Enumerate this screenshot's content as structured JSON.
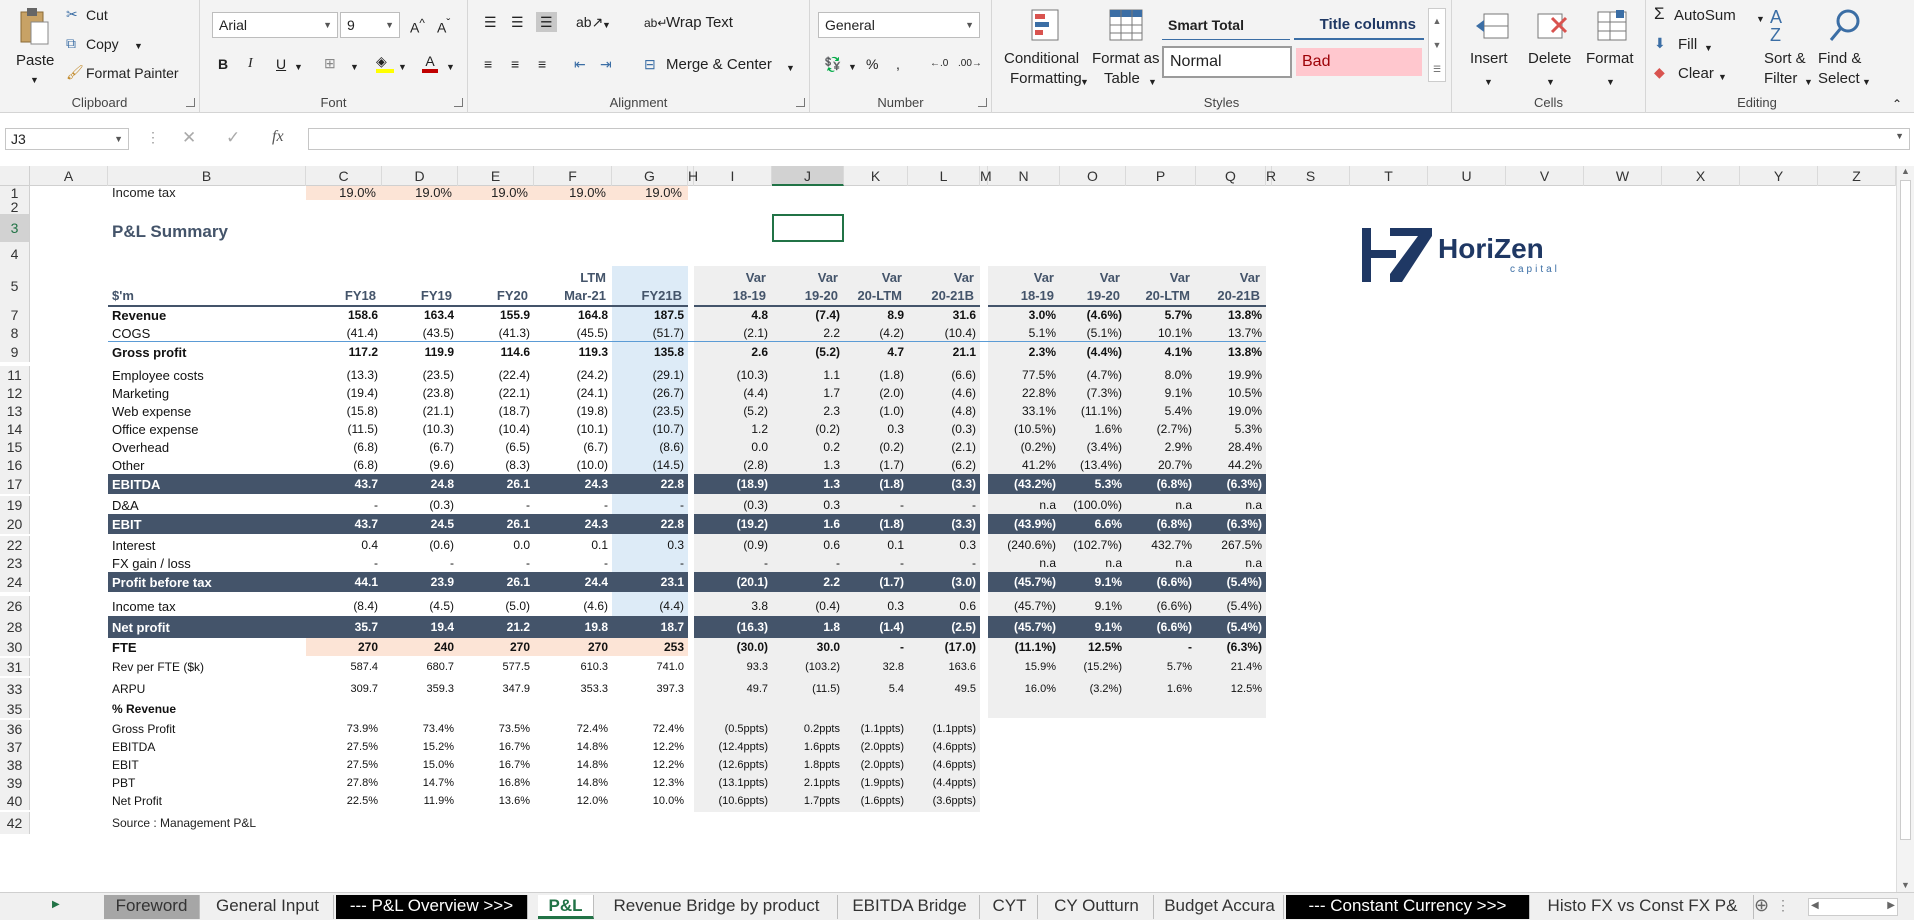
{
  "ribbon": {
    "clipboard": {
      "label": "Clipboard",
      "paste": "Paste",
      "cut": "Cut",
      "copy": "Copy",
      "format_painter": "Format Painter"
    },
    "font": {
      "label": "Font",
      "family": "Arial",
      "size": "9"
    },
    "alignment": {
      "label": "Alignment",
      "wrap_text": "Wrap Text",
      "merge_center": "Merge & Center"
    },
    "number": {
      "label": "Number",
      "format": "General"
    },
    "styles": {
      "label": "Styles",
      "conditional": "Conditional",
      "formatting": "Formatting",
      "format_as": "Format as",
      "table": "Table",
      "smart_total": "Smart Total",
      "title_columns": "Title columns",
      "normal": "Normal",
      "bad": "Bad"
    },
    "cells": {
      "label": "Cells",
      "insert": "Insert",
      "delete": "Delete",
      "format": "Format"
    },
    "editing": {
      "label": "Editing",
      "autosum": "AutoSum",
      "fill": "Fill",
      "clear": "Clear",
      "sort_filter_1": "Sort &",
      "sort_filter_2": "Filter",
      "find_select_1": "Find &",
      "find_select_2": "Select"
    }
  },
  "formula_bar": {
    "name_box": "J3",
    "fx": "fx",
    "value": ""
  },
  "columns": [
    "A",
    "B",
    "C",
    "D",
    "E",
    "F",
    "G",
    "H",
    "I",
    "J",
    "K",
    "L",
    "M",
    "N",
    "O",
    "P",
    "Q",
    "R",
    "S",
    "T",
    "U",
    "V",
    "W",
    "X",
    "Y",
    "Z"
  ],
  "rows": [
    "1",
    "2",
    "3",
    "4",
    "5",
    "7",
    "8",
    "9",
    "11",
    "12",
    "13",
    "14",
    "15",
    "16",
    "17",
    "19",
    "20",
    "22",
    "23",
    "24",
    "26",
    "28",
    "30",
    "31",
    "33",
    "35",
    "36",
    "37",
    "38",
    "39",
    "40",
    "42"
  ],
  "sheet": {
    "income_tax_label": "Income tax",
    "income_tax_rates": [
      "19.0%",
      "19.0%",
      "19.0%",
      "19.0%",
      "19.0%"
    ],
    "title": "P&L Summary",
    "unit": "$'m",
    "headers_top": [
      "",
      "",
      "",
      "LTM",
      "",
      "Var",
      "Var",
      "Var",
      "Var",
      "Var",
      "Var",
      "Var",
      "Var"
    ],
    "headers": [
      "FY18",
      "FY19",
      "FY20",
      "Mar-21",
      "FY21B",
      "18-19",
      "19-20",
      "20-LTM",
      "20-21B",
      "18-19",
      "19-20",
      "20-LTM",
      "20-21B"
    ],
    "logo_main": "HoriZen",
    "logo_sub": "capital",
    "table": [
      {
        "label": "Revenue",
        "bold": true,
        "vals": [
          "158.6",
          "163.4",
          "155.9",
          "164.8",
          "187.5",
          "4.8",
          "(7.4)",
          "8.9",
          "31.6",
          "3.0%",
          "(4.6%)",
          "5.7%",
          "13.8%"
        ]
      },
      {
        "label": "COGS",
        "vals": [
          "(41.4)",
          "(43.5)",
          "(41.3)",
          "(45.5)",
          "(51.7)",
          "(2.1)",
          "2.2",
          "(4.2)",
          "(10.4)",
          "5.1%",
          "(5.1%)",
          "10.1%",
          "13.7%"
        ]
      },
      {
        "label": "Gross profit",
        "bold": true,
        "vals": [
          "117.2",
          "119.9",
          "114.6",
          "119.3",
          "135.8",
          "2.6",
          "(5.2)",
          "4.7",
          "21.1",
          "2.3%",
          "(4.4%)",
          "4.1%",
          "13.8%"
        ]
      },
      {
        "label": "Employee costs",
        "vals": [
          "(13.3)",
          "(23.5)",
          "(22.4)",
          "(24.2)",
          "(29.1)",
          "(10.3)",
          "1.1",
          "(1.8)",
          "(6.6)",
          "77.5%",
          "(4.7%)",
          "8.0%",
          "19.9%"
        ]
      },
      {
        "label": "Marketing",
        "vals": [
          "(19.4)",
          "(23.8)",
          "(22.1)",
          "(24.1)",
          "(26.7)",
          "(4.4)",
          "1.7",
          "(2.0)",
          "(4.6)",
          "22.8%",
          "(7.3%)",
          "9.1%",
          "10.5%"
        ]
      },
      {
        "label": "Web expense",
        "vals": [
          "(15.8)",
          "(21.1)",
          "(18.7)",
          "(19.8)",
          "(23.5)",
          "(5.2)",
          "2.3",
          "(1.0)",
          "(4.8)",
          "33.1%",
          "(11.1%)",
          "5.4%",
          "19.0%"
        ]
      },
      {
        "label": "Office expense",
        "vals": [
          "(11.5)",
          "(10.3)",
          "(10.4)",
          "(10.1)",
          "(10.7)",
          "1.2",
          "(0.2)",
          "0.3",
          "(0.3)",
          "(10.5%)",
          "1.6%",
          "(2.7%)",
          "5.3%"
        ]
      },
      {
        "label": "Overhead",
        "vals": [
          "(6.8)",
          "(6.7)",
          "(6.5)",
          "(6.7)",
          "(8.6)",
          "0.0",
          "0.2",
          "(0.2)",
          "(2.1)",
          "(0.2%)",
          "(3.4%)",
          "2.9%",
          "28.4%"
        ]
      },
      {
        "label": "Other",
        "vals": [
          "(6.8)",
          "(9.6)",
          "(8.3)",
          "(10.0)",
          "(14.5)",
          "(2.8)",
          "1.3",
          "(1.7)",
          "(6.2)",
          "41.2%",
          "(13.4%)",
          "20.7%",
          "44.2%"
        ]
      },
      {
        "label": "EBITDA",
        "band": true,
        "vals": [
          "43.7",
          "24.8",
          "26.1",
          "24.3",
          "22.8",
          "(18.9)",
          "1.3",
          "(1.8)",
          "(3.3)",
          "(43.2%)",
          "5.3%",
          "(6.8%)",
          "(6.3%)"
        ]
      },
      {
        "label": "D&A",
        "vals": [
          "-",
          "(0.3)",
          "-",
          "-",
          "-",
          "(0.3)",
          "0.3",
          "-",
          "-",
          "n.a",
          "(100.0%)",
          "n.a",
          "n.a"
        ]
      },
      {
        "label": "EBIT",
        "band": true,
        "vals": [
          "43.7",
          "24.5",
          "26.1",
          "24.3",
          "22.8",
          "(19.2)",
          "1.6",
          "(1.8)",
          "(3.3)",
          "(43.9%)",
          "6.6%",
          "(6.8%)",
          "(6.3%)"
        ]
      },
      {
        "label": "Interest",
        "vals": [
          "0.4",
          "(0.6)",
          "0.0",
          "0.1",
          "0.3",
          "(0.9)",
          "0.6",
          "0.1",
          "0.3",
          "(240.6%)",
          "(102.7%)",
          "432.7%",
          "267.5%"
        ]
      },
      {
        "label": "FX gain / loss",
        "vals": [
          "-",
          "-",
          "-",
          "-",
          "-",
          "-",
          "-",
          "-",
          "-",
          "n.a",
          "n.a",
          "n.a",
          "n.a"
        ]
      },
      {
        "label": "Profit before tax",
        "band": true,
        "vals": [
          "44.1",
          "23.9",
          "26.1",
          "24.4",
          "23.1",
          "(20.1)",
          "2.2",
          "(1.7)",
          "(3.0)",
          "(45.7%)",
          "9.1%",
          "(6.6%)",
          "(5.4%)"
        ]
      },
      {
        "label": "Income tax",
        "vals": [
          "(8.4)",
          "(4.5)",
          "(5.0)",
          "(4.6)",
          "(4.4)",
          "3.8",
          "(0.4)",
          "0.3",
          "0.6",
          "(45.7%)",
          "9.1%",
          "(6.6%)",
          "(5.4%)"
        ]
      },
      {
        "label": "Net profit",
        "band": true,
        "vals": [
          "35.7",
          "19.4",
          "21.2",
          "19.8",
          "18.7",
          "(16.3)",
          "1.8",
          "(1.4)",
          "(2.5)",
          "(45.7%)",
          "9.1%",
          "(6.6%)",
          "(5.4%)"
        ]
      },
      {
        "label": "FTE",
        "bold": true,
        "vals": [
          "270",
          "240",
          "270",
          "270",
          "253",
          "(30.0)",
          "30.0",
          "-",
          "(17.0)",
          "(11.1%)",
          "12.5%",
          "-",
          "(6.3%)"
        ]
      },
      {
        "label": "Rev per FTE ($k)",
        "vals": [
          "587.4",
          "680.7",
          "577.5",
          "610.3",
          "741.0",
          "93.3",
          "(103.2)",
          "32.8",
          "163.6",
          "15.9%",
          "(15.2%)",
          "5.7%",
          "21.4%"
        ]
      },
      {
        "label": "ARPU",
        "vals": [
          "309.7",
          "359.3",
          "347.9",
          "353.3",
          "397.3",
          "49.7",
          "(11.5)",
          "5.4",
          "49.5",
          "16.0%",
          "(3.2%)",
          "1.6%",
          "12.5%"
        ]
      },
      {
        "label": "% Revenue",
        "bold": true,
        "vals": [
          "",
          "",
          "",
          "",
          "",
          "",
          "",
          "",
          "",
          "",
          "",
          "",
          ""
        ]
      },
      {
        "label": "Gross Profit",
        "vals": [
          "73.9%",
          "73.4%",
          "73.5%",
          "72.4%",
          "72.4%",
          "(0.5ppts)",
          "0.2ppts",
          "(1.1ppts)",
          "(1.1ppts)",
          "",
          "",
          "",
          ""
        ]
      },
      {
        "label": "EBITDA",
        "vals": [
          "27.5%",
          "15.2%",
          "16.7%",
          "14.8%",
          "12.2%",
          "(12.4ppts)",
          "1.6ppts",
          "(2.0ppts)",
          "(4.6ppts)",
          "",
          "",
          "",
          ""
        ]
      },
      {
        "label": "EBIT",
        "vals": [
          "27.5%",
          "15.0%",
          "16.7%",
          "14.8%",
          "12.2%",
          "(12.6ppts)",
          "1.8ppts",
          "(2.0ppts)",
          "(4.6ppts)",
          "",
          "",
          "",
          ""
        ]
      },
      {
        "label": "PBT",
        "vals": [
          "27.8%",
          "14.7%",
          "16.8%",
          "14.8%",
          "12.3%",
          "(13.1ppts)",
          "2.1ppts",
          "(1.9ppts)",
          "(4.4ppts)",
          "",
          "",
          "",
          ""
        ]
      },
      {
        "label": "Net Profit",
        "vals": [
          "22.5%",
          "11.9%",
          "13.6%",
          "12.0%",
          "10.0%",
          "(10.6ppts)",
          "1.7ppts",
          "(1.6ppts)",
          "(3.6ppts)",
          "",
          "",
          "",
          ""
        ]
      }
    ],
    "source": "Source : Management P&L"
  },
  "tabs": [
    "Foreword",
    "General Input",
    "--- P&L Overview >>>",
    "P&L",
    "Revenue Bridge by product",
    "EBITDA Bridge",
    "CYT",
    "CY Outturn",
    "Budget Accura",
    "--- Constant Currency >>>",
    "Histo FX vs Const FX P&"
  ],
  "colors": {
    "band": "#44546a",
    "pink": "#fce4d6",
    "budget": "#ddebf7",
    "accent": "#217346"
  }
}
